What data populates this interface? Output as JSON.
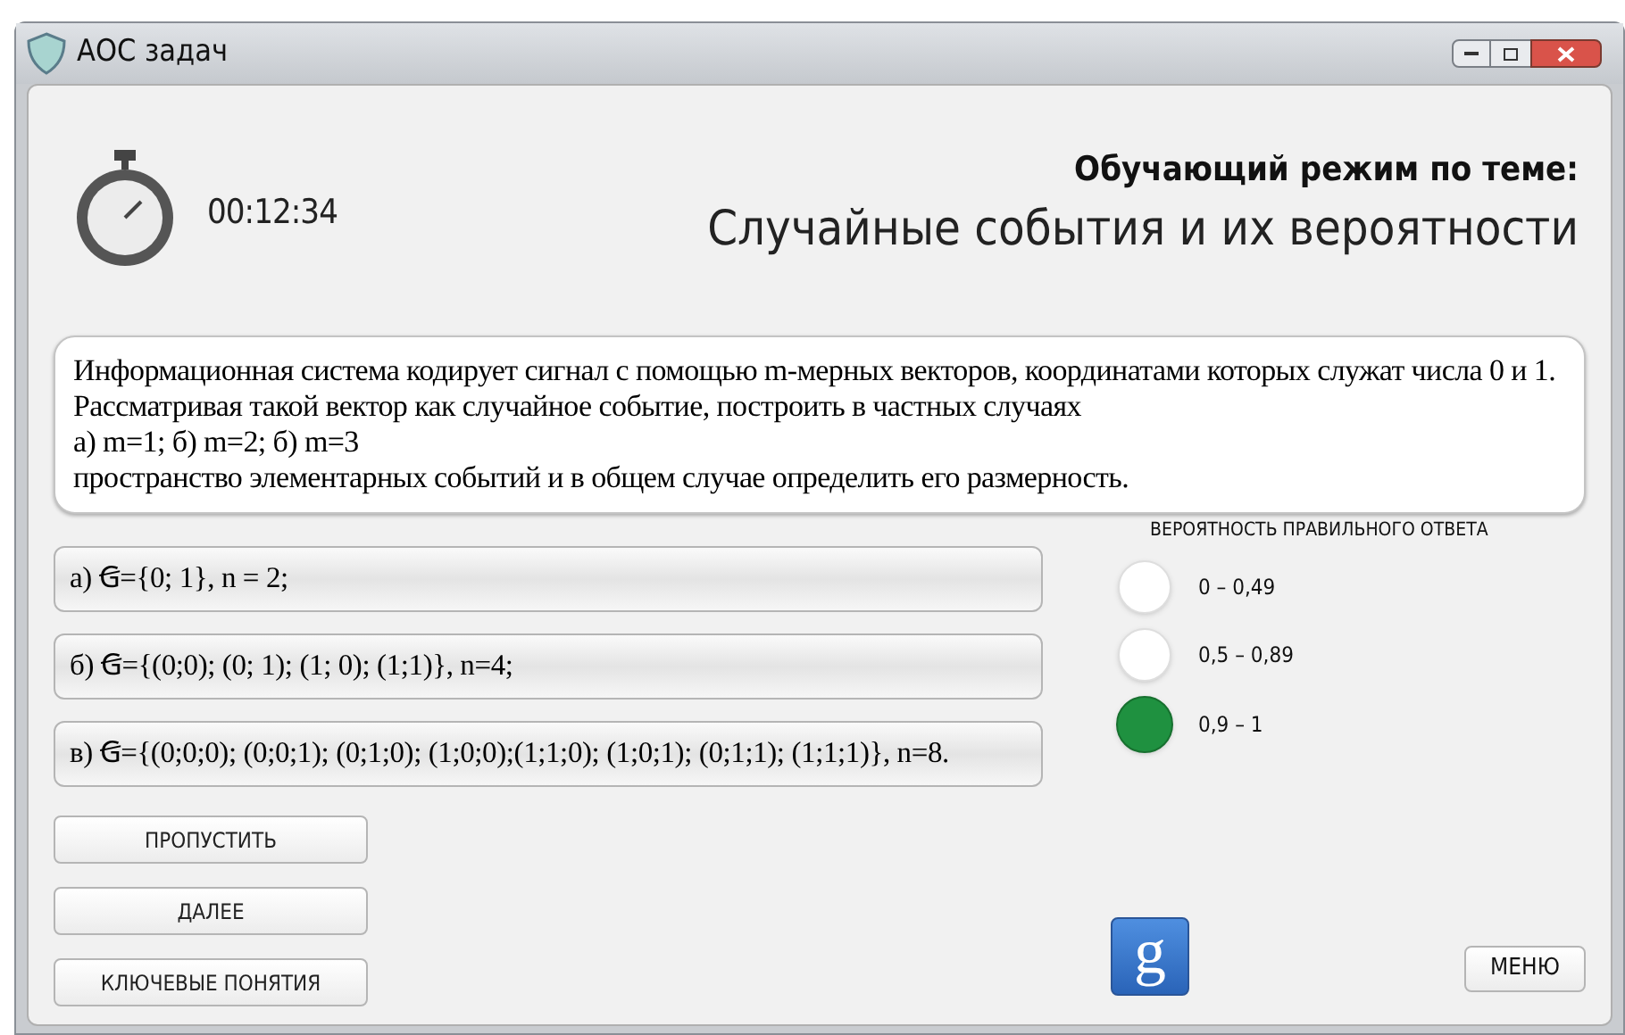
{
  "window": {
    "title": "АОС задач"
  },
  "timer": {
    "time": "00:12:34"
  },
  "header": {
    "mode": "Обучающий режим по теме:",
    "topic": "Случайные события и их вероятности"
  },
  "problem": {
    "lines": [
      "Информационная система кодирует сигнал с помощью m-мерных векторов, координатами которых служат числа 0 и 1.",
      "Рассматривая такой вектор как случайное событие, построить в частных случаях",
      "а) m=1; б) m=2; б) m=3",
      "пространство элементарных событий и в общем случае определить его размерность."
    ]
  },
  "answers": [
    {
      "text": "а) Ꞡ={0; 1}, n = 2;"
    },
    {
      "text": "б) Ꞡ={(0;0); (0; 1); (1; 0); (1;1)}, n=4;"
    },
    {
      "text": "в) Ꞡ={(0;0;0); (0;0;1); (0;1;0); (1;0;0);(1;1;0); (1;0;1); (0;1;1); (1;1;1)}, n=8."
    }
  ],
  "probability": {
    "title": "ВЕРОЯТНОСТЬ ПРАВИЛЬНОГО ОТВЕТА",
    "options": [
      {
        "label": "0 – 0,49",
        "selected": false
      },
      {
        "label": "0,5 – 0,89",
        "selected": false
      },
      {
        "label": "0,9 – 1",
        "selected": true
      }
    ]
  },
  "buttons": [
    "ПРОПУСТИТЬ",
    "ДАЛЕЕ",
    "КЛЮЧЕВЫЕ ПОНЯТИЯ"
  ],
  "search_button": {
    "label": "g"
  },
  "menu_button": {
    "label": "МЕНЮ"
  }
}
